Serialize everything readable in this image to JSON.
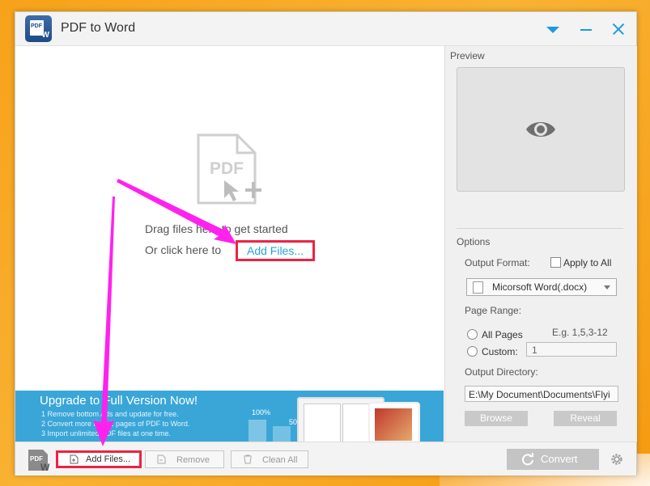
{
  "window": {
    "title": "PDF to Word",
    "logo_text": "PDF",
    "logo_mark": "W"
  },
  "dropzone": {
    "icon_text": "PDF",
    "drag_text": "Drag files here to get started",
    "or_text": "Or click here to",
    "add_link": "Add Files..."
  },
  "banner": {
    "title": "Upgrade to Full Version Now!",
    "lines": [
      "1 Remove bottom Ads and update for free.",
      "2 Convert more than 2 pages of PDF to Word.",
      "3 Import unlimited PDF files at one time."
    ],
    "pct1": "100%",
    "pct2": "50"
  },
  "panel": {
    "preview_label": "Preview",
    "options_label": "Options",
    "output_format_label": "Output Format:",
    "apply_all_label": "Apply to All",
    "format_selected": "Micorsoft Word(.docx)",
    "page_range_label": "Page Range:",
    "all_pages_label": "All Pages",
    "example_text": "E.g. 1,5,3-12",
    "custom_label": "Custom:",
    "custom_value": "1",
    "output_dir_label": "Output Directory:",
    "output_dir_value": "E:\\My Document\\Documents\\Flyi",
    "browse_label": "Browse",
    "reveal_label": "Reveal"
  },
  "toolbar": {
    "logo_text": "PDF",
    "logo_mark": "W",
    "add_files_label": "Add Files...",
    "remove_label": "Remove",
    "clean_all_label": "Clean All",
    "convert_label": "Convert"
  },
  "colors": {
    "accent": "#1a9be0",
    "highlight_box": "#ee2244",
    "annotation_arrow": "#ff22ee",
    "banner_bg": "#3aa6d8"
  }
}
